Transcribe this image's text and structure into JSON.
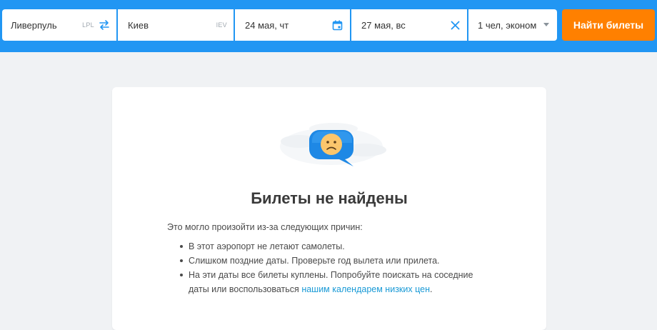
{
  "search": {
    "origin": {
      "city": "Ливерпуль",
      "code": "LPL"
    },
    "destination": {
      "city": "Киев",
      "code": "IEV"
    },
    "depart_date": "24 мая, чт",
    "return_date": "27 мая, вс",
    "passengers": "1 чел, эконом",
    "button_label": "Найти билеты"
  },
  "icons": {
    "swap": "swap-arrows-icon",
    "calendar": "calendar-icon",
    "clear": "close-icon",
    "dropdown": "chevron-down-icon",
    "illustration": "sad-face-bubble-icon"
  },
  "colors": {
    "header": "#2196f3",
    "button": "#ff8000",
    "link": "#1a9ad6",
    "page_bg": "#f0f2f4"
  },
  "empty_state": {
    "title": "Билеты не найдены",
    "intro": "Это могло произойти из-за следующих причин:",
    "reasons": [
      "В этот аэропорт не летают самолеты.",
      "Слишком поздние даты. Проверьте год вылета или прилета."
    ],
    "reason3_text": "На эти даты все билеты куплены. Попробуйте поискать на соседние даты или воспользоваться",
    "reason3_link": "нашим календарем низких цен",
    "reason3_end": "."
  }
}
